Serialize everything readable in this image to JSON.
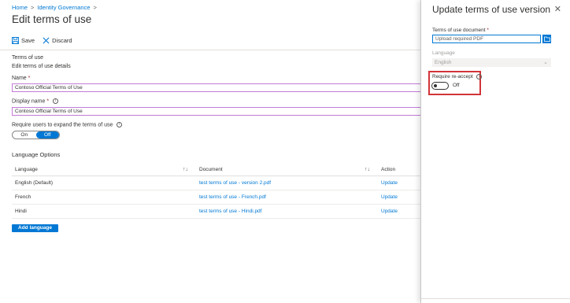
{
  "breadcrumb": {
    "home": "Home",
    "sep": ">",
    "section": "Identity Governance"
  },
  "page": {
    "title": "Edit terms of use"
  },
  "toolbar": {
    "save": "Save",
    "discard": "Discard"
  },
  "terms": {
    "heading": "Terms of use",
    "subheading": "Edit terms of use details",
    "name_label": "Name",
    "required_mark": "*",
    "name_value": "Contoso Official Terms of Use",
    "display_name_label": "Display name",
    "display_name_value": "Contoso Official Terms of Use",
    "expand_label": "Require users to expand the terms of use",
    "expand_on": "On",
    "expand_off": "Off"
  },
  "language_options": {
    "title": "Language Options",
    "columns": {
      "language": "Language",
      "document": "Document",
      "action": "Action"
    },
    "rows": [
      {
        "language": "English (Default)",
        "document": "test terms of use - version 2.pdf",
        "action": "Update"
      },
      {
        "language": "French",
        "document": "test terms of use - French.pdf",
        "action": "Update"
      },
      {
        "language": "Hindi",
        "document": "test terms of use - Hindi.pdf",
        "action": "Update"
      }
    ],
    "add_button": "Add language"
  },
  "panel": {
    "title": "Update terms of use version",
    "document_label": "Terms of use document",
    "document_placeholder": "Upload required PDF",
    "language_label": "Language",
    "language_value": "English",
    "reaccept_label": "Require re-accept",
    "reaccept_state": "Off"
  },
  "icons": {
    "save": "save-icon",
    "discard": "close-icon",
    "info": "info-icon",
    "sort": "sort-icon",
    "folder": "folder-icon",
    "chevron": "chevron-down-icon",
    "close": "close-icon"
  },
  "colors": {
    "accent": "#0078d4",
    "highlight": "#d13438",
    "field_border": "#c27bd6"
  }
}
